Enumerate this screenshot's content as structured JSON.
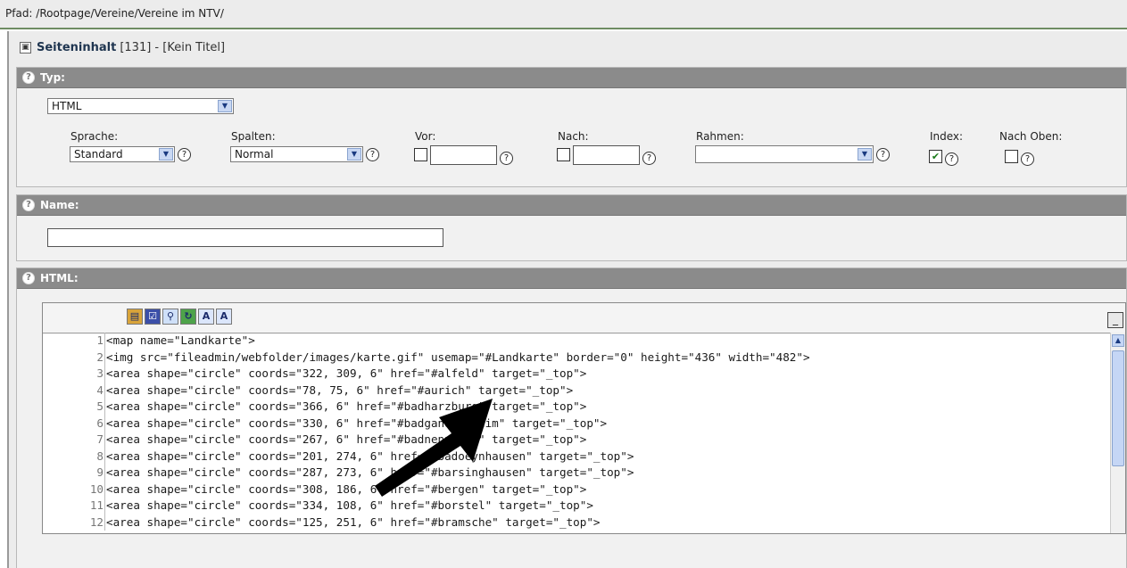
{
  "breadcrumb": {
    "text": "Pfad: /Rootpage/Vereine/Vereine im NTV/"
  },
  "content_header": {
    "title_bold": "Seiteninhalt",
    "title_rest": "[131] - [Kein Titel]"
  },
  "type_section": {
    "heading": "Typ:",
    "type_value": "HTML",
    "fields": {
      "sprache": {
        "label": "Sprache:",
        "value": "Standard"
      },
      "spalten": {
        "label": "Spalten:",
        "value": "Normal"
      },
      "vor": {
        "label": "Vor:",
        "checked": false,
        "value": ""
      },
      "nach": {
        "label": "Nach:",
        "checked": false,
        "value": ""
      },
      "rahmen": {
        "label": "Rahmen:",
        "value": ""
      },
      "index": {
        "label": "Index:",
        "checked": true
      },
      "nach_oben": {
        "label": "Nach Oben:",
        "checked": false
      }
    },
    "help_glyph": "?"
  },
  "name_section": {
    "heading": "Name:",
    "value": ""
  },
  "html_section": {
    "heading": "HTML:",
    "toolbar_icons": [
      {
        "name": "document-icon",
        "glyph": "▤",
        "bg": "#d9a43a"
      },
      {
        "name": "checkbox-icon",
        "glyph": "☑",
        "bg": "#3b4fa8"
      },
      {
        "name": "search-icon",
        "glyph": "⚲",
        "bg": "#cfe0f8"
      },
      {
        "name": "refresh-icon",
        "glyph": "↻",
        "bg": "#4ea34a"
      },
      {
        "name": "text-a-icon",
        "glyph": "A",
        "bg": "#dbe6fb"
      },
      {
        "name": "text-a-alt-icon",
        "glyph": "A",
        "bg": "#dbe6fb"
      }
    ],
    "minimize_glyph": "_",
    "scroll_glyph": "▲",
    "code_lines": [
      {
        "n": "1",
        "text": "<map name=\"Landkarte\">"
      },
      {
        "n": "2",
        "text": "<img src=\"fileadmin/webfolder/images/karte.gif\" usemap=\"#Landkarte\" border=\"0\" height=\"436\" width=\"482\">"
      },
      {
        "n": "3",
        "text": "<area shape=\"circle\" coords=\"322, 309, 6\" href=\"#alfeld\" target=\"_top\">"
      },
      {
        "n": "4",
        "text": "<area shape=\"circle\" coords=\"78, 75, 6\" href=\"#aurich\" target=\"_top\">"
      },
      {
        "n": "5",
        "text": "<area shape=\"circle\" coords=\"366, 6\" href=\"#badharzburg\" target=\"_top\">"
      },
      {
        "n": "6",
        "text": "<area shape=\"circle\" coords=\"330, 6\" href=\"#badgandersheim\" target=\"_top\">"
      },
      {
        "n": "7",
        "text": "<area shape=\"circle\" coords=\"267, 6\" href=\"#badnenndorf\" target=\"_top\">"
      },
      {
        "n": "8",
        "text": "<area shape=\"circle\" coords=\"201, 274, 6\" href=\"#badoeynhausen\" target=\"_top\">"
      },
      {
        "n": "9",
        "text": "<area shape=\"circle\" coords=\"287, 273, 6\" href=\"#barsinghausen\" target=\"_top\">"
      },
      {
        "n": "10",
        "text": "<area shape=\"circle\" coords=\"308, 186, 6\" href=\"#bergen\" target=\"_top\">"
      },
      {
        "n": "11",
        "text": "<area shape=\"circle\" coords=\"334, 108, 6\" href=\"#borstel\" target=\"_top\">"
      },
      {
        "n": "12",
        "text": "<area shape=\"circle\" coords=\"125, 251, 6\" href=\"#bramsche\" target=\"_top\">"
      }
    ]
  },
  "colors": {
    "section_header": "#8b8b8b",
    "accent_green": "#6f8d63",
    "arrow": "#000000"
  }
}
